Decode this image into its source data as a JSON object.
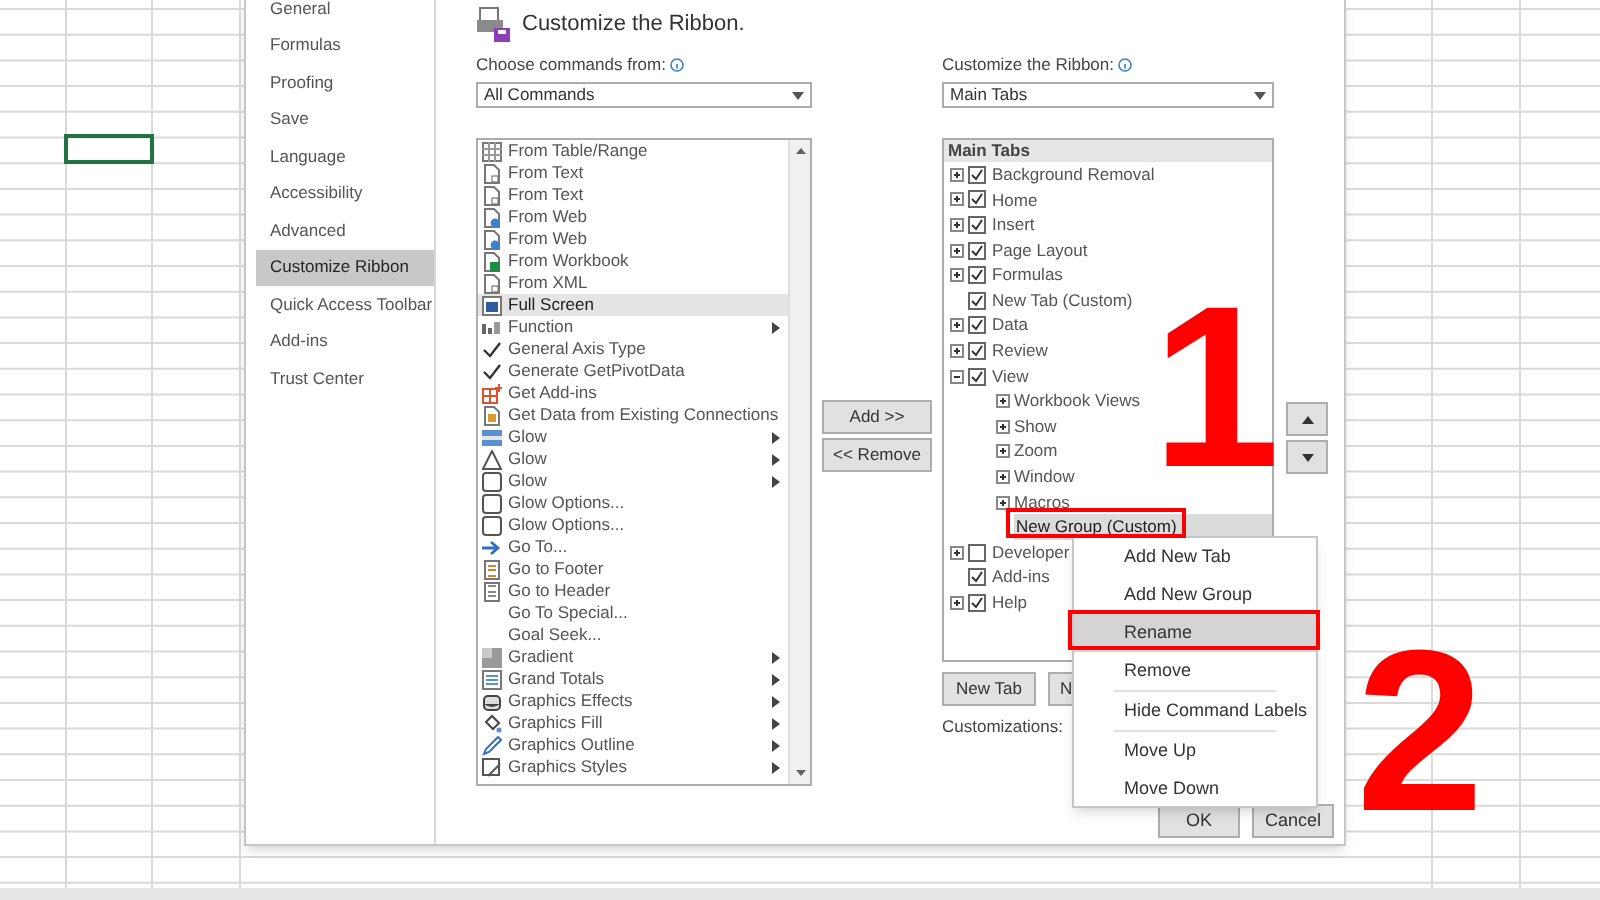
{
  "sidebar": {
    "items": [
      {
        "label": "General",
        "selected": false
      },
      {
        "label": "Formulas",
        "selected": false
      },
      {
        "label": "Proofing",
        "selected": false
      },
      {
        "label": "Save",
        "selected": false
      },
      {
        "label": "Language",
        "selected": false
      },
      {
        "label": "Accessibility",
        "selected": false
      },
      {
        "label": "Advanced",
        "selected": false
      },
      {
        "label": "Customize Ribbon",
        "selected": true
      },
      {
        "label": "Quick Access Toolbar",
        "selected": false
      },
      {
        "label": "Add-ins",
        "selected": false
      },
      {
        "label": "Trust Center",
        "selected": false
      }
    ]
  },
  "header": {
    "title": "Customize the Ribbon."
  },
  "commands": {
    "label": "Choose commands from:",
    "dropdown": "All Commands",
    "items": [
      {
        "label": "From Table/Range",
        "kind": "table",
        "selected": false,
        "submenu": false
      },
      {
        "label": "From Text",
        "kind": "page",
        "selected": false,
        "submenu": false
      },
      {
        "label": "From Text",
        "kind": "page",
        "selected": false,
        "submenu": false
      },
      {
        "label": "From Web",
        "kind": "web",
        "selected": false,
        "submenu": false
      },
      {
        "label": "From Web",
        "kind": "web",
        "selected": false,
        "submenu": false
      },
      {
        "label": "From Workbook",
        "kind": "workbook",
        "selected": false,
        "submenu": false
      },
      {
        "label": "From XML",
        "kind": "page",
        "selected": false,
        "submenu": false
      },
      {
        "label": "Full Screen",
        "kind": "fullscreen",
        "selected": true,
        "submenu": false
      },
      {
        "label": "Function",
        "kind": "function",
        "selected": false,
        "submenu": true
      },
      {
        "label": "General Axis Type",
        "kind": "check",
        "selected": false,
        "submenu": false
      },
      {
        "label": "Generate GetPivotData",
        "kind": "check",
        "selected": false,
        "submenu": false
      },
      {
        "label": "Get Add-ins",
        "kind": "addins",
        "selected": false,
        "submenu": false
      },
      {
        "label": "Get Data from Existing Connections",
        "kind": "connections",
        "selected": false,
        "submenu": false
      },
      {
        "label": "Glow",
        "kind": "glowfill",
        "selected": false,
        "submenu": true
      },
      {
        "label": "Glow",
        "kind": "glowtext",
        "selected": false,
        "submenu": true
      },
      {
        "label": "Glow",
        "kind": "square",
        "selected": false,
        "submenu": true
      },
      {
        "label": "Glow Options...",
        "kind": "square",
        "selected": false,
        "submenu": false
      },
      {
        "label": "Glow Options...",
        "kind": "square",
        "selected": false,
        "submenu": false
      },
      {
        "label": "Go To...",
        "kind": "arrow",
        "selected": false,
        "submenu": false
      },
      {
        "label": "Go to Footer",
        "kind": "footer",
        "selected": false,
        "submenu": false
      },
      {
        "label": "Go to Header",
        "kind": "header",
        "selected": false,
        "submenu": false
      },
      {
        "label": "Go To Special...",
        "kind": "none",
        "selected": false,
        "submenu": false
      },
      {
        "label": "Goal Seek...",
        "kind": "none",
        "selected": false,
        "submenu": false
      },
      {
        "label": "Gradient",
        "kind": "gradient",
        "selected": false,
        "submenu": true
      },
      {
        "label": "Grand Totals",
        "kind": "totals",
        "selected": false,
        "submenu": true
      },
      {
        "label": "Graphics Effects",
        "kind": "effects",
        "selected": false,
        "submenu": true
      },
      {
        "label": "Graphics Fill",
        "kind": "fill",
        "selected": false,
        "submenu": true
      },
      {
        "label": "Graphics Outline",
        "kind": "outline",
        "selected": false,
        "submenu": true
      },
      {
        "label": "Graphics Styles",
        "kind": "styles",
        "selected": false,
        "submenu": true
      }
    ]
  },
  "transfer_buttons": [
    "Add >>",
    "<< Remove"
  ],
  "ribbon": {
    "label": "Customize the Ribbon:",
    "dropdown": "Main Tabs",
    "header": "Main Tabs",
    "items": [
      {
        "label": "Background Removal",
        "expanded": false,
        "checked": true,
        "selected": false
      },
      {
        "label": "Home",
        "expanded": false,
        "checked": true,
        "selected": false
      },
      {
        "label": "Insert",
        "expanded": false,
        "checked": true,
        "selected": false
      },
      {
        "label": "Page Layout",
        "expanded": false,
        "checked": true,
        "selected": false
      },
      {
        "label": "Formulas",
        "expanded": false,
        "checked": true,
        "selected": false
      },
      {
        "label": "New Tab (Custom)",
        "checked": true,
        "selected": false
      },
      {
        "label": "Data",
        "expanded": false,
        "checked": true,
        "selected": false
      },
      {
        "label": "Review",
        "expanded": false,
        "checked": true,
        "selected": false
      },
      {
        "label": "View",
        "expanded": true,
        "checked": true,
        "selected": false,
        "children": [
          {
            "label": "Workbook Views",
            "expanded": false,
            "selected": false
          },
          {
            "label": "Show",
            "expanded": false,
            "selected": false
          },
          {
            "label": "Zoom",
            "expanded": false,
            "selected": false
          },
          {
            "label": "Window",
            "expanded": false,
            "selected": false
          },
          {
            "label": "Macros",
            "expanded": false,
            "selected": false
          },
          {
            "label": "New Group (Custom)",
            "selected": true
          }
        ]
      },
      {
        "label": "Developer",
        "expanded": false,
        "checked": false,
        "selected": false
      },
      {
        "label": "Add-ins",
        "checked": true,
        "selected": false
      },
      {
        "label": "Help",
        "expanded": false,
        "checked": true,
        "selected": false
      }
    ]
  },
  "tree_buttons": [
    "New Tab",
    "N"
  ],
  "customizations": {
    "label": "Customizations:"
  },
  "footer_buttons": [
    "OK",
    "Cancel"
  ],
  "context_menu": {
    "items": [
      {
        "label": "Add New Tab",
        "selected": false,
        "separator_before": false
      },
      {
        "label": "Add New Group",
        "selected": false,
        "separator_before": false
      },
      {
        "label": "Rename",
        "selected": true,
        "separator_before": false
      },
      {
        "label": "Remove",
        "selected": false,
        "separator_before": false
      },
      {
        "label": "Hide Command Labels",
        "selected": false,
        "separator_before": true
      },
      {
        "label": "Move Up",
        "selected": false,
        "separator_before": true
      },
      {
        "label": "Move Down",
        "selected": false,
        "separator_before": false
      }
    ]
  },
  "annotations": [
    {
      "label": "1"
    },
    {
      "label": "2"
    }
  ]
}
